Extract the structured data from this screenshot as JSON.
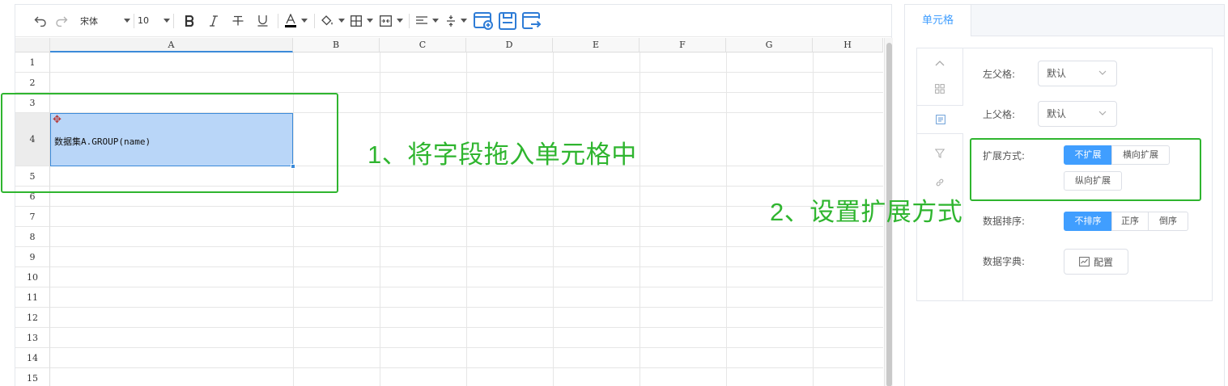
{
  "toolbar": {
    "font_name": "宋体",
    "font_size": "10",
    "text_color": "#000000"
  },
  "sheet": {
    "columns": [
      {
        "label": "A"
      },
      {
        "label": "B"
      },
      {
        "label": "C"
      },
      {
        "label": "D"
      },
      {
        "label": "E"
      },
      {
        "label": "F"
      },
      {
        "label": "G"
      },
      {
        "label": "H"
      }
    ],
    "rows": [
      "1",
      "2",
      "3",
      "4",
      "5",
      "6",
      "7",
      "8",
      "9",
      "10",
      "11",
      "12",
      "13",
      "14",
      "15"
    ],
    "selected_cell_text": "数据集A.GROUP(name)",
    "selection_color": "#b9d6f8",
    "accent_color": "#3b8ad9"
  },
  "annotations": {
    "step1": "1、将字段拖入单元格中",
    "step2": "2、设置扩展方式",
    "color": "#2fb52f"
  },
  "panel": {
    "tab": "单元格",
    "left_parent": {
      "label": "左父格:",
      "value": "默认"
    },
    "top_parent": {
      "label": "上父格:",
      "value": "默认"
    },
    "expand": {
      "label": "扩展方式:",
      "options": [
        "不扩展",
        "横向扩展",
        "纵向扩展"
      ],
      "selected": "不扩展"
    },
    "sort": {
      "label": "数据排序:",
      "options": [
        "不排序",
        "正序",
        "倒序"
      ],
      "selected": "不排序"
    },
    "dict": {
      "label": "数据字典:",
      "button": "配置"
    },
    "primary_color": "#409eff"
  }
}
